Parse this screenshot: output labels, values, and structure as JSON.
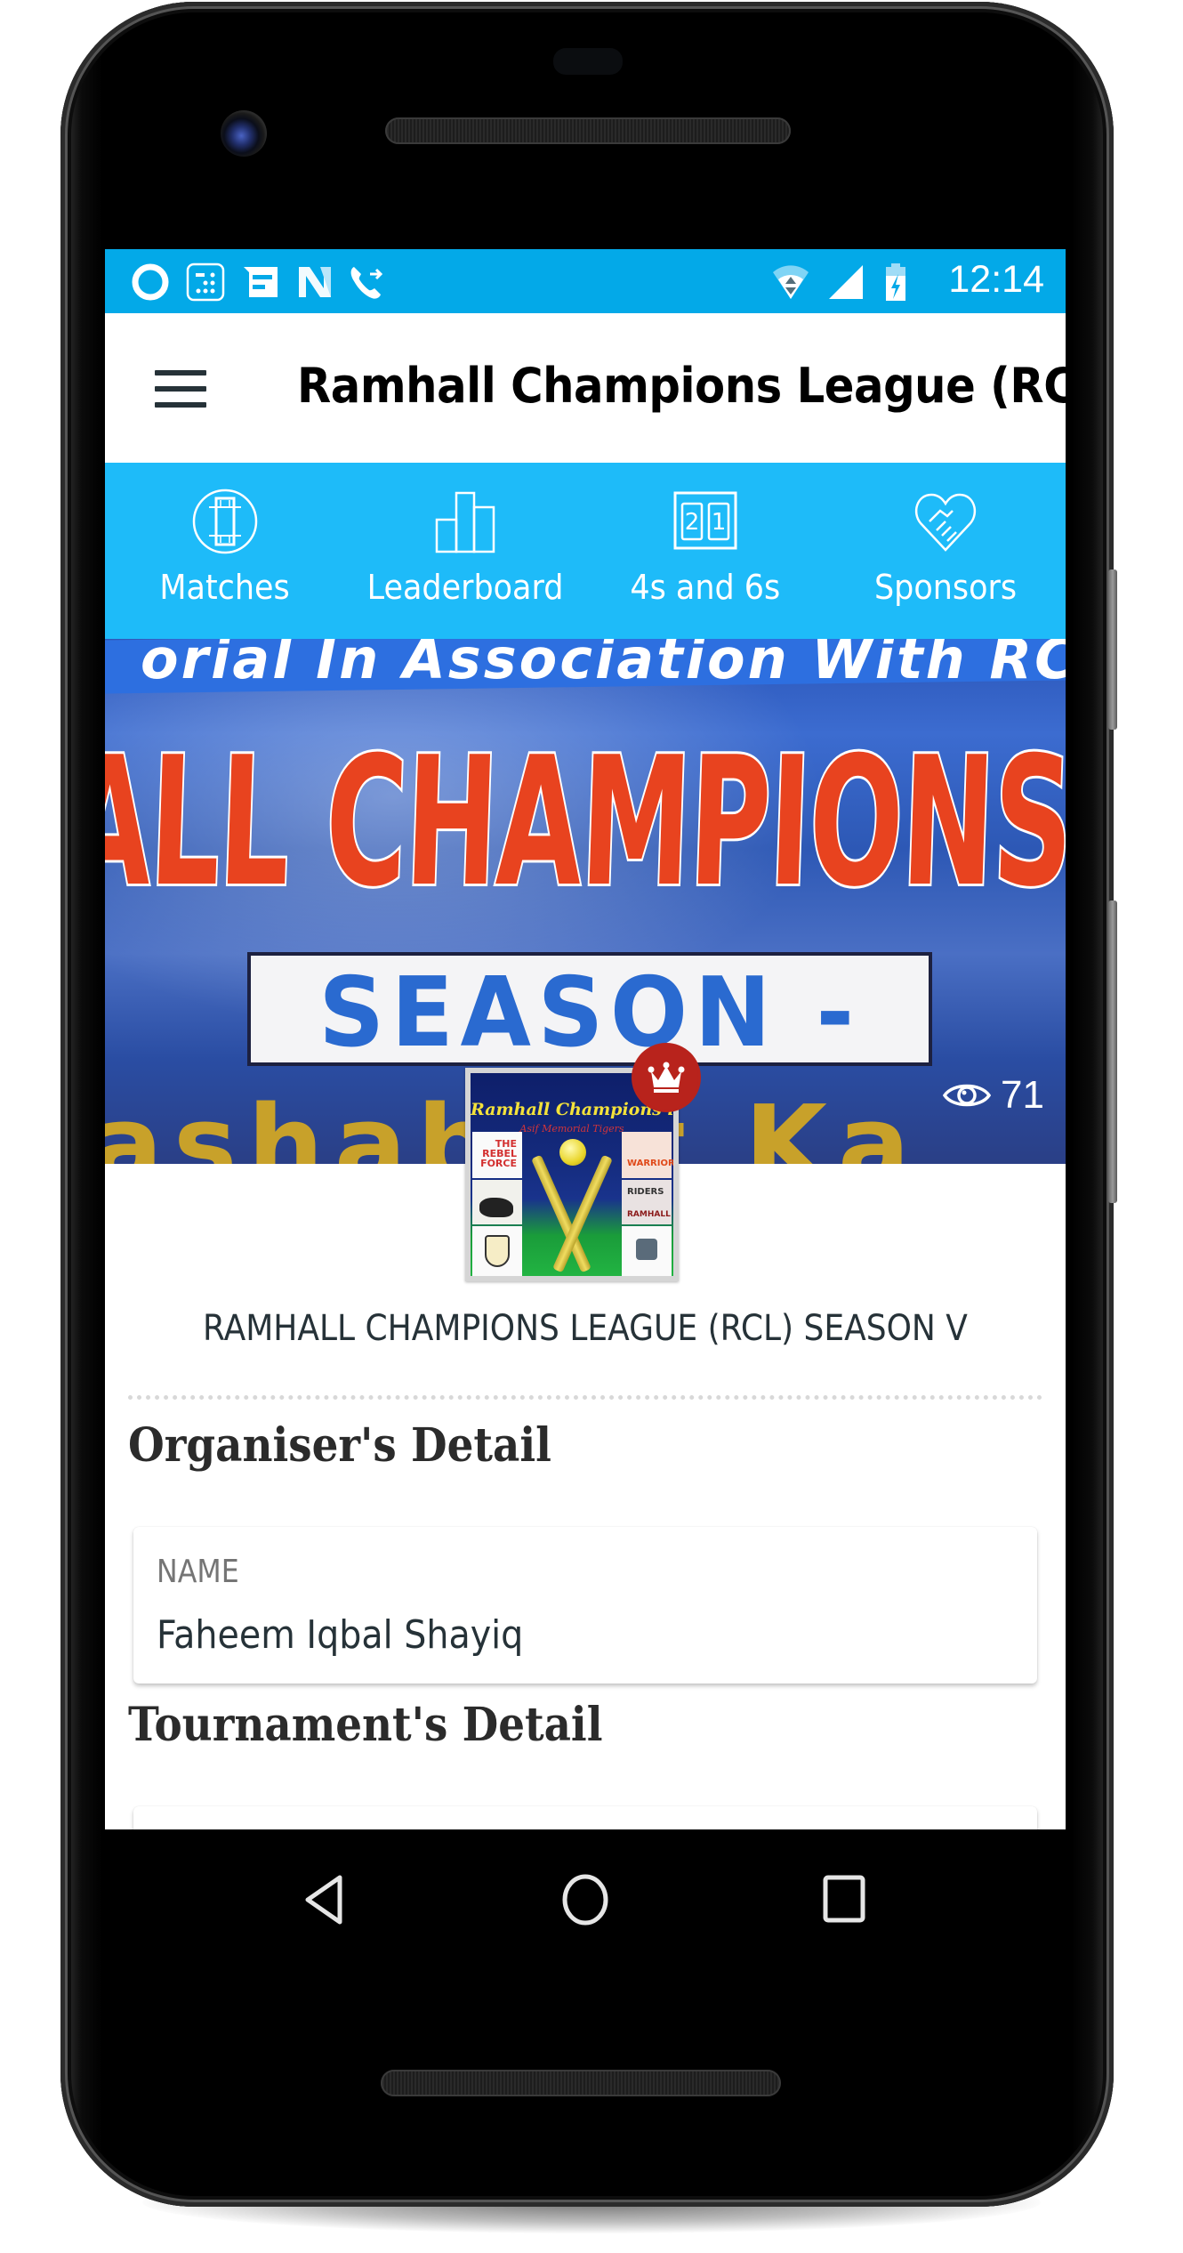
{
  "status_bar": {
    "left_icons": [
      "circle-app-icon",
      "dialpad-icon",
      "messages-icon",
      "n-logo-icon",
      "call-forward-icon"
    ],
    "right_icons": [
      "wifi-icon",
      "signal-icon",
      "battery-charging-icon"
    ],
    "time": "12:14"
  },
  "header": {
    "menu_icon": "hamburger-menu-icon",
    "title": "Ramhall Champions League (RCL)"
  },
  "tabs": [
    {
      "label": "Matches",
      "icon": "cricket-pitch-icon"
    },
    {
      "label": "Leaderboard",
      "icon": "bar-podium-icon"
    },
    {
      "label": "4s and 6s",
      "icon": "scoreboard-icon"
    },
    {
      "label": "Sponsors",
      "icon": "handshake-heart-icon"
    }
  ],
  "banner": {
    "top_text": "orial In Association With RCL",
    "main_text": "ALL CHAMPIONS L",
    "season_text": "SEASON - V",
    "bottom_text": "ashab  et  Ka",
    "views": "71",
    "views_icon": "eye-icon"
  },
  "logo": {
    "title": "Ramhall Champions league",
    "subtitle": "Asif Memorial Tigers",
    "badge_icon": "crown-icon"
  },
  "tournament": {
    "title": "RAMHALL CHAMPIONS LEAGUE (RCL) SEASON V"
  },
  "organiser": {
    "heading": "Organiser's Detail",
    "fields": [
      {
        "label": "NAME",
        "value": "Faheem Iqbal Shayiq"
      }
    ]
  },
  "tournament_detail": {
    "heading": "Tournament's Detail"
  },
  "nav_bar": {
    "buttons": [
      "back-icon",
      "home-icon",
      "recents-icon"
    ]
  },
  "colors": {
    "status_bar": "#03a9e8",
    "tab_bar": "#1ebbf9",
    "crown_badge": "#b8231c",
    "title_text": "#263238"
  }
}
